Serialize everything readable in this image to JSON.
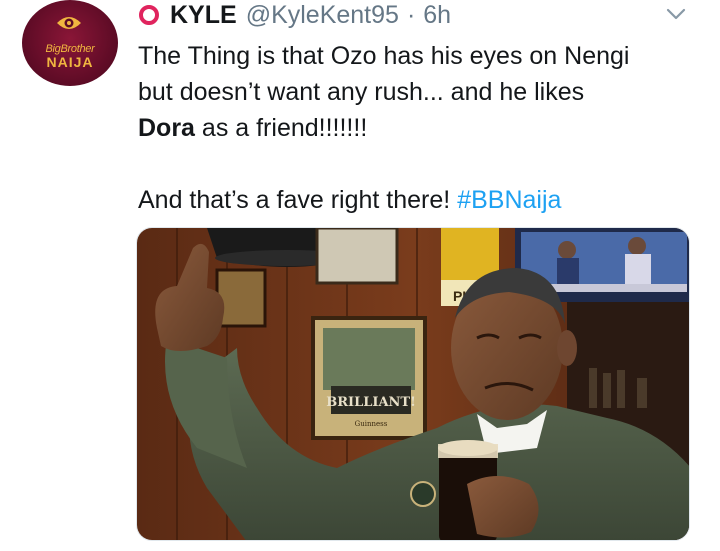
{
  "tweet": {
    "avatar": {
      "line1": "BigBrother",
      "line2": "NAIJA"
    },
    "display_name": "KYLE",
    "handle": "@KyleKent95",
    "separator": "·",
    "time": "6h",
    "text": {
      "line1": "The Thing is that Ozo has his eyes on Nengi",
      "line2": "but doesn’t want any rush... and he likes",
      "line3_bold": "Dora",
      "line3_rest": " as a friend!!!!!!!",
      "line4_text": "And that’s a fave right there! ",
      "line4_hashtag": "#BBNaija"
    },
    "media": {
      "sign_text": "BRILLIANT!",
      "sign_sub": "Guinness",
      "poster_text": "PU"
    }
  },
  "colors": {
    "accent": "#1da1f2",
    "text": "#14171a",
    "muted": "#657786",
    "ring": "#e0245e",
    "avatar_bg": "#6b0f2c",
    "avatar_text": "#f0b640"
  },
  "icons": {
    "status": "red-ring-icon",
    "more": "chevron-down-icon",
    "avatar_logo": "eye-logo-icon"
  }
}
